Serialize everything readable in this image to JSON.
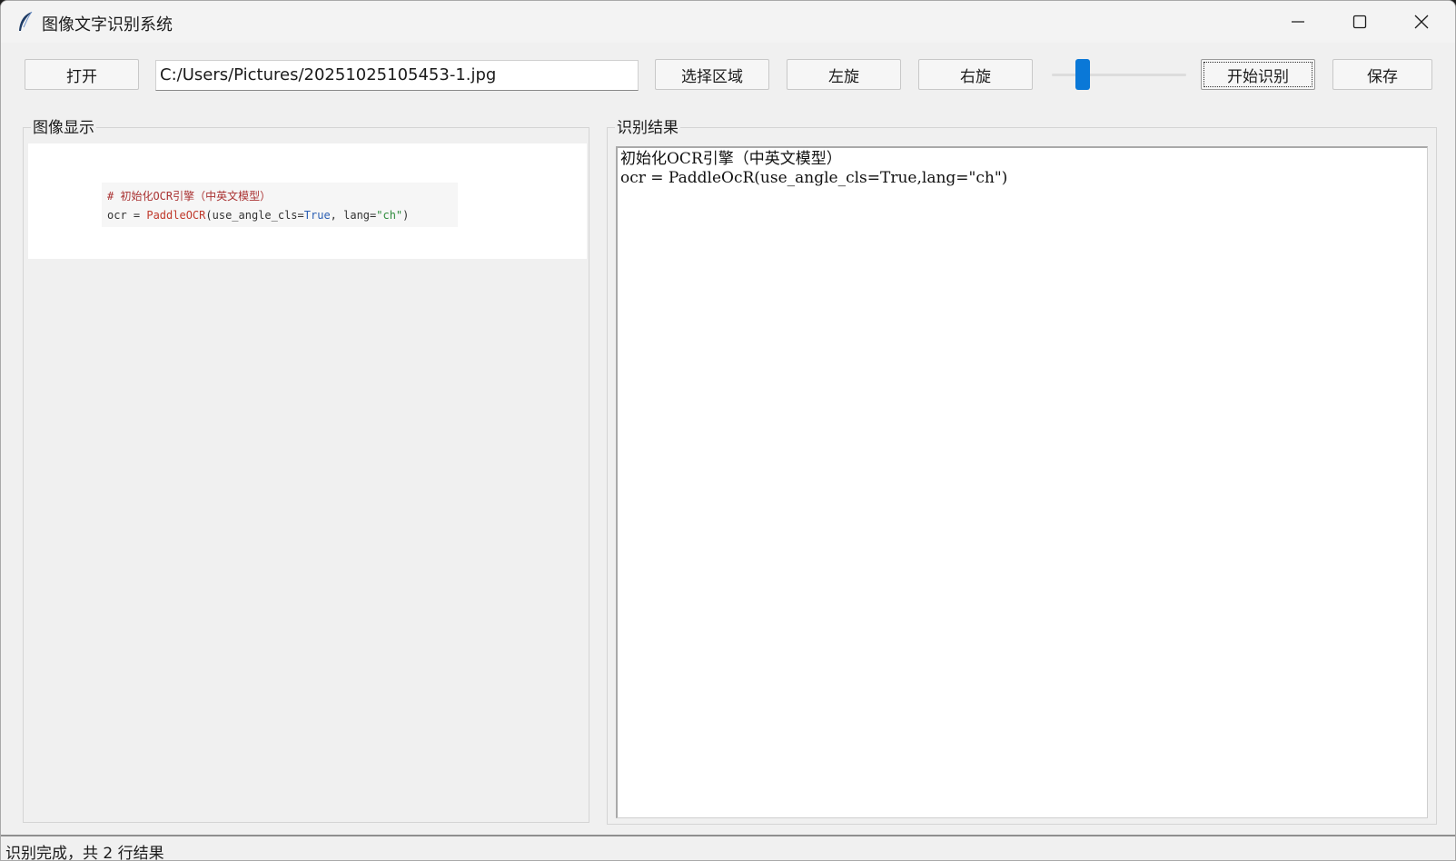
{
  "window": {
    "title": "图像文字识别系统",
    "icons": {
      "app": "feather-icon",
      "minimize": "minimize-icon",
      "maximize": "maximize-icon",
      "close": "close-icon"
    }
  },
  "toolbar": {
    "open_label": "打开",
    "file_path": "C:/Users/Pictures/20251025105453-1.jpg",
    "select_region_label": "选择区域",
    "rotate_left_label": "左旋",
    "rotate_right_label": "右旋",
    "zoom_slider_fraction": 0.2,
    "start_label": "开始识别",
    "save_label": "保存"
  },
  "image_panel": {
    "label": "图像显示",
    "preview": {
      "line1": "# 初始化OCR引擎（中英文模型）",
      "line2_parts": [
        "ocr = ",
        "PaddleOCR",
        "(use_angle_cls=",
        "True",
        ", lang=",
        "\"ch\"",
        ")"
      ]
    }
  },
  "result_panel": {
    "label": "识别结果",
    "text": "初始化OCR引擎（中英文模型）\nocr = PaddleOcR(use_angle_cls=True,lang=\"ch\")"
  },
  "status": {
    "text": "识别完成，共 2 行结果"
  },
  "colors": {
    "accent": "#0a78d7",
    "background": "#f0f0f0"
  }
}
